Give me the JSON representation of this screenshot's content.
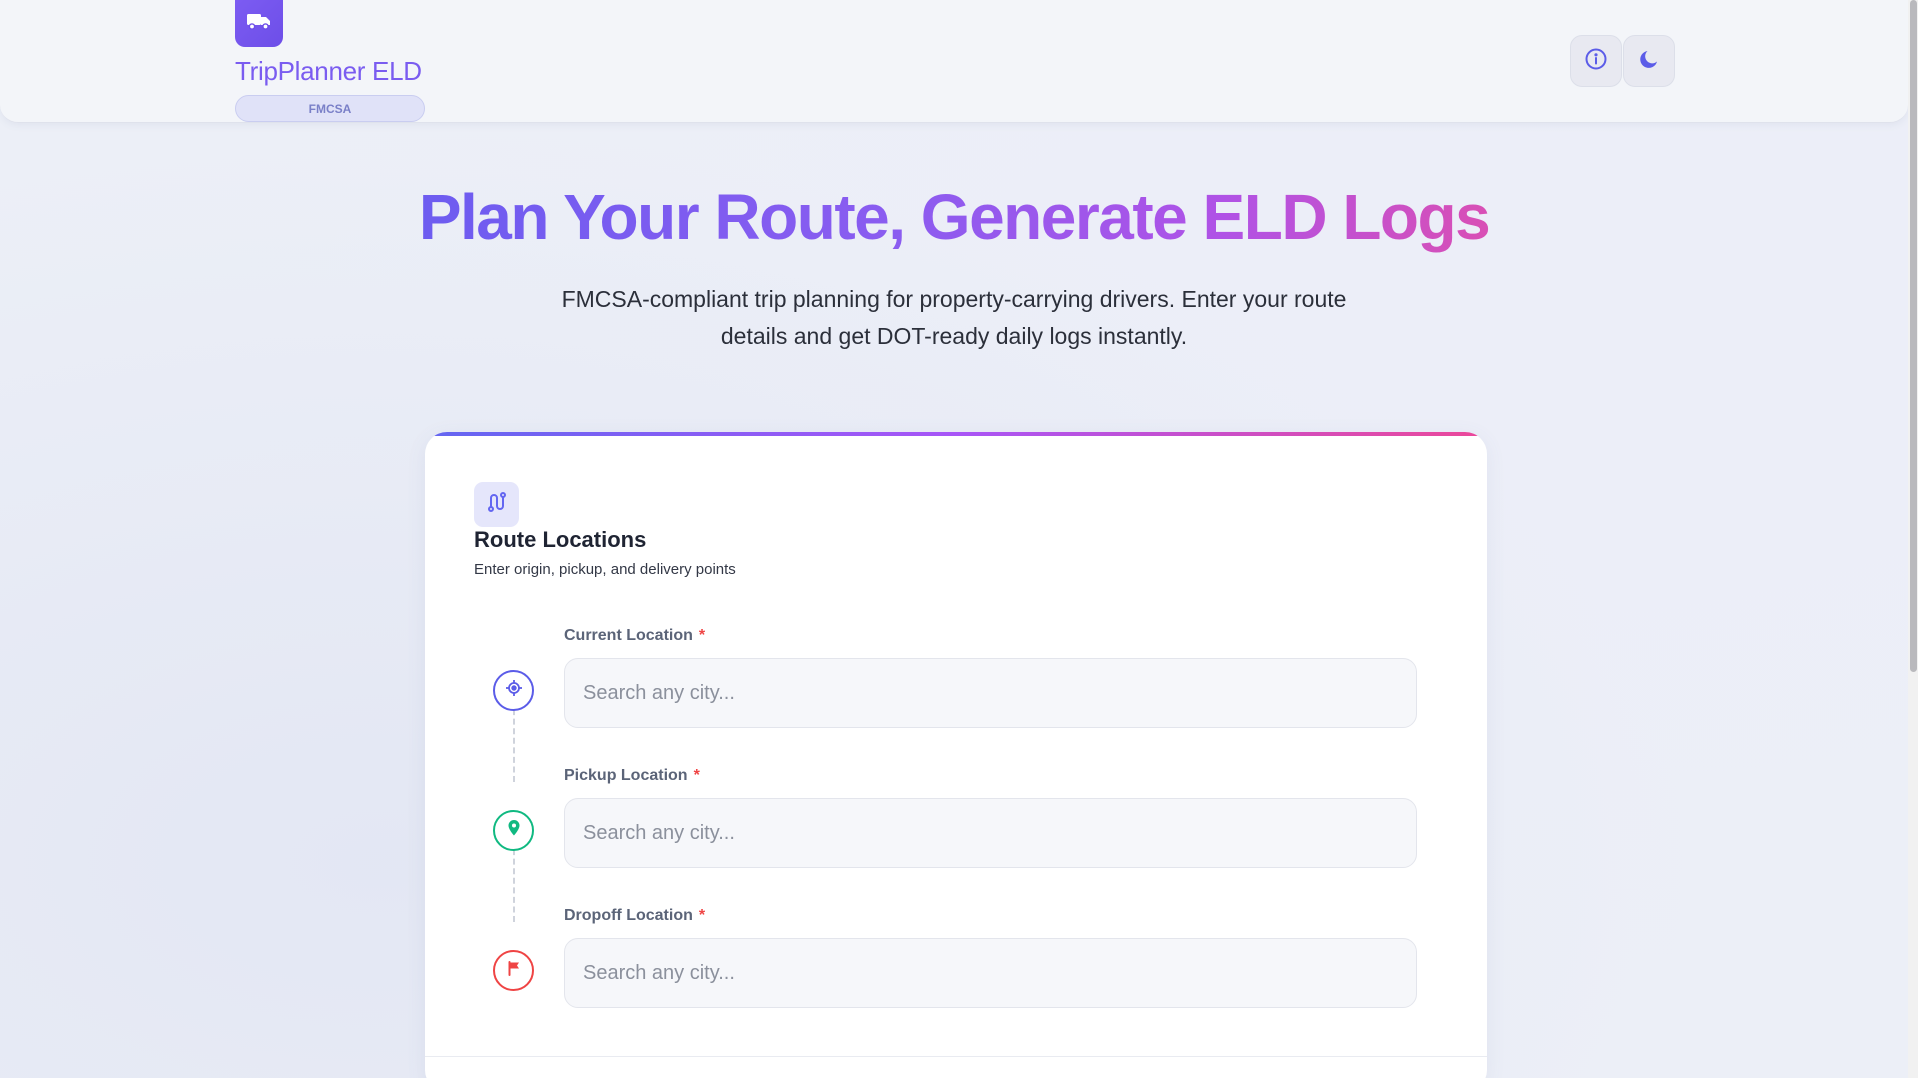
{
  "header": {
    "brand": "TripPlanner ELD",
    "badge": "FMCSA",
    "logo_icon": "truck-icon",
    "info_icon": "info-icon",
    "theme_icon": "moon-icon"
  },
  "hero": {
    "title": "Plan Your Route, Generate ELD Logs",
    "subtitle": "FMCSA-compliant trip planning for property-carrying drivers. Enter your route details and get DOT-ready daily logs instantly."
  },
  "route_section": {
    "icon": "route-icon",
    "title": "Route Locations",
    "subtitle": "Enter origin, pickup, and delivery points",
    "fields": [
      {
        "label": "Current Location",
        "required_mark": "*",
        "placeholder": "Search any city...",
        "value": "",
        "icon": "crosshair-icon"
      },
      {
        "label": "Pickup Location",
        "required_mark": "*",
        "placeholder": "Search any city...",
        "value": "",
        "icon": "map-pin-icon"
      },
      {
        "label": "Dropoff Location",
        "required_mark": "*",
        "placeholder": "Search any city...",
        "value": "",
        "icon": "flag-icon"
      }
    ]
  },
  "colors": {
    "accent": "#7c5cf2",
    "current": "#5b5ce8",
    "pickup": "#10b981",
    "dropoff": "#ef4444"
  }
}
